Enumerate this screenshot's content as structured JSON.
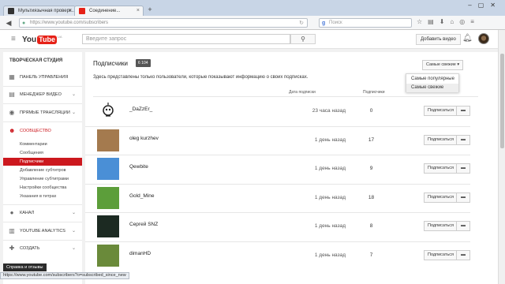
{
  "browser": {
    "tabs": [
      {
        "label": "Мультиязычная проверк...",
        "favicon_color": "#333333"
      },
      {
        "label": "Соединение...",
        "favicon_color": "#e62117"
      }
    ],
    "url": "https://www.youtube.com/subscribers",
    "search_placeholder": "Поиск",
    "status_url": "https://www.youtube.com/subscribers?o=subscribed_since_new"
  },
  "header": {
    "logo_you": "You",
    "logo_tube": "Tube",
    "logo_country": "UA",
    "search_placeholder": "Введите запрос",
    "upload_label": "Добавить видео"
  },
  "sidebar": {
    "studio_title": "ТВОРЧЕСКАЯ СТУДИЯ",
    "items": [
      {
        "label": "ПАНЕЛЬ УПРАВЛЕНИЯ",
        "icon": "dashboard-icon"
      },
      {
        "label": "МЕНЕДЖЕР ВИДЕО",
        "icon": "video-manager-icon"
      },
      {
        "label": "ПРЯМЫЕ ТРАНСЛЯЦИИ",
        "icon": "live-stream-icon"
      },
      {
        "label": "СООБЩЕСТВО",
        "icon": "community-icon"
      },
      {
        "label": "КАНАЛ",
        "icon": "channel-icon"
      },
      {
        "label": "YOUTUBE ANALYTICS",
        "icon": "analytics-icon"
      },
      {
        "label": "СОЗДАТЬ",
        "icon": "create-icon"
      }
    ],
    "community_sub": [
      "Комментарии",
      "Сообщения",
      "Подписчики",
      "Добавление субтитров",
      "Управление субтитрами",
      "Настройки сообщества",
      "Указания в титрах"
    ],
    "active_sub_index": 2,
    "feedback_label": "Справка и отзывы"
  },
  "main": {
    "title": "Подписчики",
    "count": "6 104",
    "sort_label": "Самые свежие",
    "description": "Здесь представлены только пользователи, которые показывают информацию о своих подписках.",
    "sort_options": [
      "Самые популярные",
      "Самые свежие"
    ],
    "col_date": "Дата подписки",
    "col_subs": "Подписчики",
    "subscribe_label": "Подписаться",
    "rows": [
      {
        "name": "_DaZzEr_",
        "date": "23 часа назад",
        "subs": "0",
        "avatar_bg": "#ffffff"
      },
      {
        "name": "oleg kurzhev",
        "date": "1 день назад",
        "subs": "17",
        "avatar_bg": "#a47a4e"
      },
      {
        "name": "Qewbite",
        "date": "1 день назад",
        "subs": "9",
        "avatar_bg": "#4a8fd6"
      },
      {
        "name": "Gold_Mine",
        "date": "1 день назад",
        "subs": "18",
        "avatar_bg": "#5c9e3a"
      },
      {
        "name": "Сергей SNZ",
        "date": "1 день назад",
        "subs": "8",
        "avatar_bg": "#1c2a22"
      },
      {
        "name": "dimanHD",
        "date": "1 день назад",
        "subs": "7",
        "avatar_bg": "#6a8a3a"
      }
    ]
  }
}
